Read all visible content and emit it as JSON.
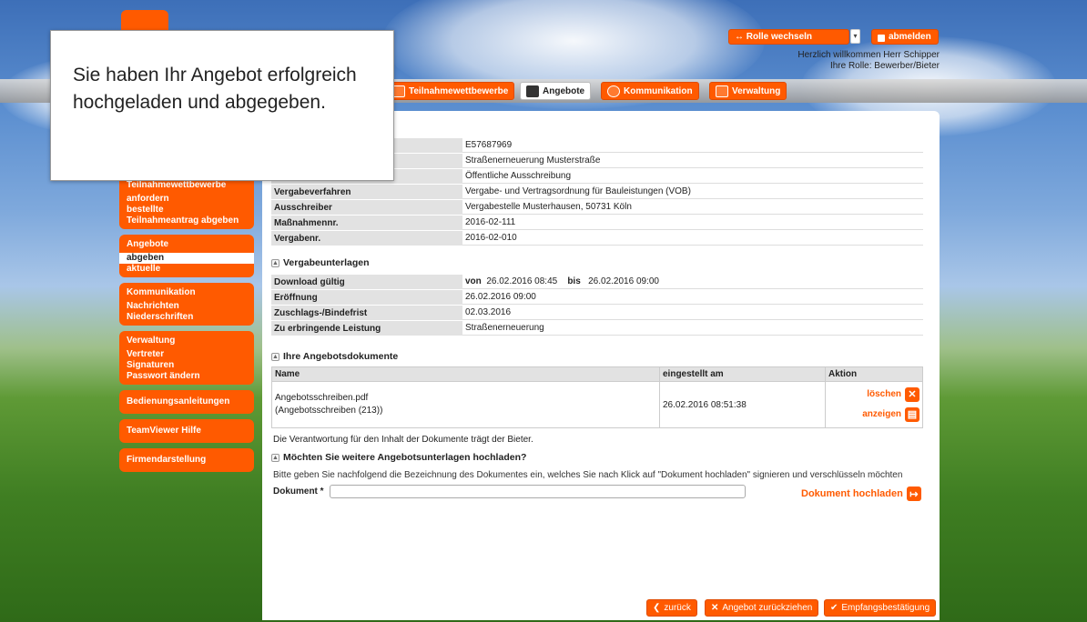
{
  "header": {
    "role_switch_label": "↔ Rolle wechseln",
    "select_arrow": "▾",
    "logout_label": "abmelden",
    "welcome_line": "Herzlich willkommen Herr Schipper",
    "role_line": "Ihre Rolle: Bewerber/Bieter"
  },
  "tabs": [
    {
      "label": "Teilnahmewettbewerbe",
      "icon": "document-icon"
    },
    {
      "label": "Angebote",
      "icon": "envelope-icon"
    },
    {
      "label": "Kommunikation",
      "icon": "people-icon"
    },
    {
      "label": "Verwaltung",
      "icon": "calendar-icon"
    }
  ],
  "sidebar": {
    "groups": [
      {
        "head": "Teilnahmewettbewerbe",
        "items": [
          "anfordern",
          "bestellte",
          "Teilnahmeantrag abgeben"
        ]
      },
      {
        "head": "Angebote",
        "items": [
          "abgeben",
          "aktuelle"
        ]
      },
      {
        "head": "Kommunikation",
        "items": [
          "Nachrichten",
          "Niederschriften"
        ]
      },
      {
        "head": "Verwaltung",
        "items": [
          "Vertreter",
          "Signaturen",
          "Passwort ändern"
        ]
      }
    ],
    "singles": [
      "Bedienungsanleitungen",
      "TeamViewer Hilfe",
      "Firmendarstellung"
    ]
  },
  "details": [
    {
      "key": "",
      "value": "E57687969"
    },
    {
      "key": "",
      "value": "Straßenerneuerung Musterstraße"
    },
    {
      "key": "",
      "value": "Öffentliche Ausschreibung"
    },
    {
      "key": "Vergabeverfahren",
      "value": "Vergabe- und Vertragsordnung für Bauleistungen (VOB)"
    },
    {
      "key": "Ausschreiber",
      "value": "Vergabestelle Musterhausen, 50731 Köln"
    },
    {
      "key": "Maßnahmennr.",
      "value": "2016-02-111"
    },
    {
      "key": "Vergabenr.",
      "value": "2016-02-010"
    }
  ],
  "vergabeunterlagen": {
    "title": "Vergabeunterlagen",
    "download_label": "Download gültig",
    "von_label": "von",
    "von_value": "26.02.2016 08:45",
    "bis_label": "bis",
    "bis_value": "26.02.2016 09:00",
    "rows": [
      {
        "key": "Eröffnung",
        "value": "26.02.2016 09:00"
      },
      {
        "key": "Zuschlags-/Bindefrist",
        "value": "02.03.2016"
      },
      {
        "key": "Zu erbringende Leistung",
        "value": "Straßenerneuerung"
      }
    ]
  },
  "angebotsdokumente": {
    "title": "Ihre Angebotsdokumente",
    "columns": [
      "Name",
      "eingestellt am",
      "Aktion"
    ],
    "rows": [
      {
        "name": "Angebotsschreiben.pdf",
        "subname": "(Angebotsschreiben (213))",
        "date": "26.02.2016 08:51:38",
        "delete": "löschen",
        "view": "anzeigen"
      }
    ],
    "note": "Die Verantwortung für den Inhalt der Dokumente trägt der Bieter."
  },
  "upload": {
    "title": "Möchten Sie weitere Angebotsunterlagen hochladen?",
    "instruction": "Bitte geben Sie nachfolgend die Bezeichnung des Dokumentes ein, welches Sie nach Klick auf \"Dokument hochladen\" signieren und verschlüsseln möchten",
    "field_label": "Dokument *",
    "field_value": "",
    "button": "Dokument hochladen"
  },
  "bottom": {
    "back": "zurück",
    "withdraw": "Angebot zurückziehen",
    "receipt": "Empfangsbestätigung"
  },
  "modal": {
    "message": "Sie haben Ihr Angebot erfolgreich hochgeladen und abgegeben."
  },
  "colors": {
    "accent": "#ff5a00",
    "label_bg": "#e2e2e2"
  }
}
